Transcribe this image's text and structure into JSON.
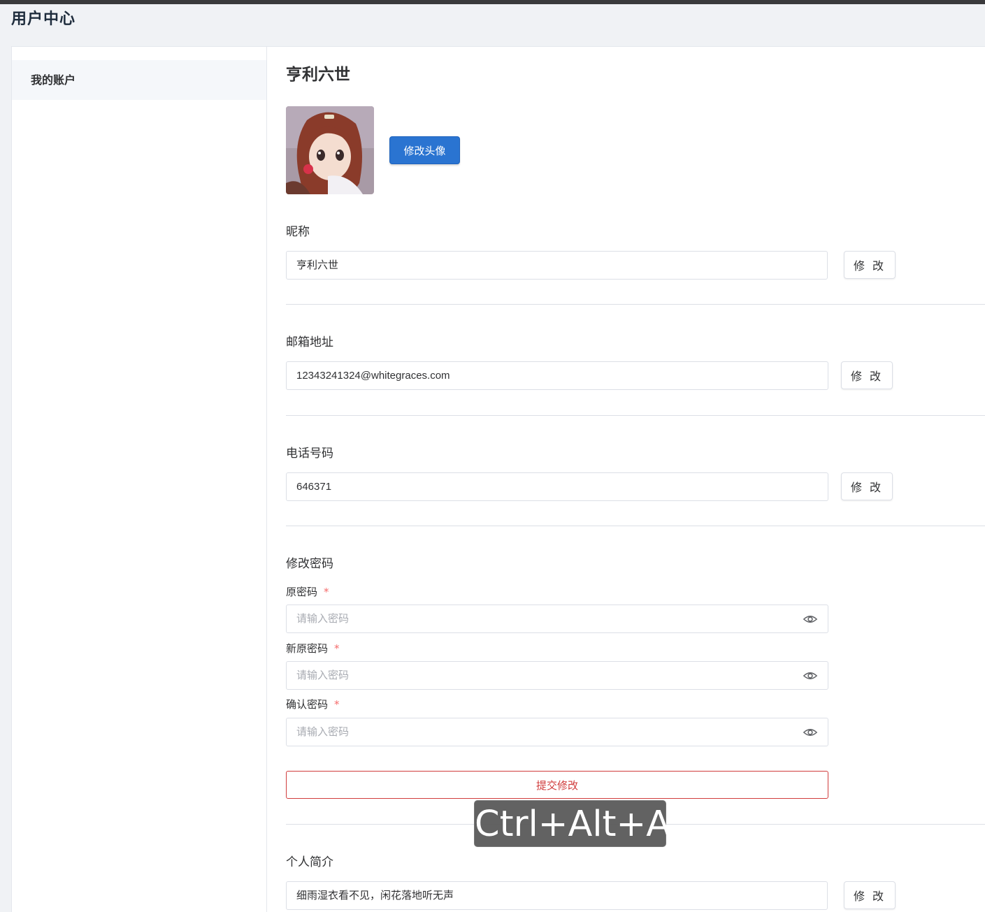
{
  "header": {
    "title": "用户中心"
  },
  "sidebar": {
    "items": [
      {
        "label": "我的账户"
      }
    ]
  },
  "profile": {
    "username": "亨利六世",
    "change_avatar_label": "修改头像"
  },
  "nickname": {
    "label": "昵称",
    "value": "亨利六世",
    "edit_label": "修 改"
  },
  "email": {
    "label": "邮箱地址",
    "value": "12343241324@whitegraces.com",
    "edit_label": "修 改"
  },
  "phone": {
    "label": "电话号码",
    "value": "646371",
    "edit_label": "修 改"
  },
  "password": {
    "section_label": "修改密码",
    "old_label": "原密码",
    "new_label": "新原密码",
    "confirm_label": "确认密码",
    "required_mark": "*",
    "placeholder": "请输入密码",
    "submit_label": "提交修改"
  },
  "bio": {
    "label": "个人简介",
    "value": "细雨湿衣看不见，闲花落地听无声",
    "edit_label": "修 改"
  },
  "overlay": {
    "shortcut": "Ctrl+Alt+A"
  },
  "colors": {
    "primary": "#2a74d1",
    "danger": "#d03c3c",
    "required": "#f56c6c"
  }
}
